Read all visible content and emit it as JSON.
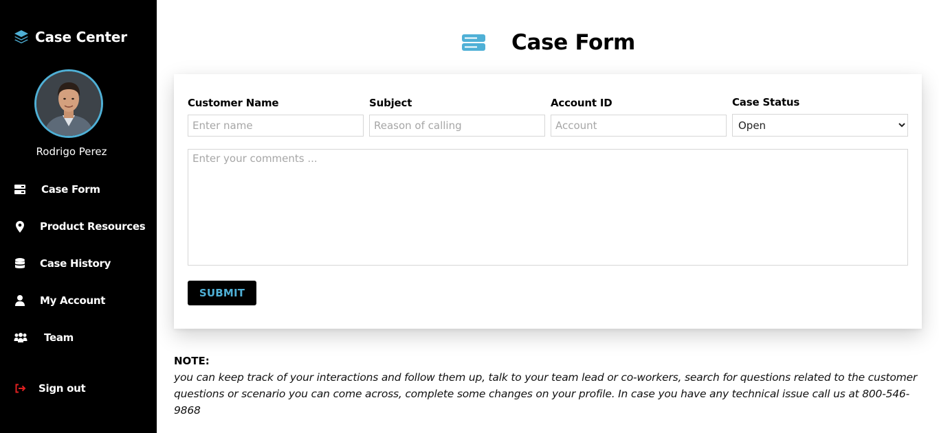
{
  "sidebar": {
    "brand": {
      "title": "Case Center",
      "icon": "layers-icon"
    },
    "user": {
      "name": "Rodrigo Perez",
      "avatar_icon": "avatar"
    },
    "items": [
      {
        "label": "Case Form",
        "icon": "server-icon"
      },
      {
        "label": "Product Resources",
        "icon": "map-pin-icon"
      },
      {
        "label": "Case History",
        "icon": "database-icon"
      },
      {
        "label": "My Account",
        "icon": "user-icon"
      },
      {
        "label": "Team",
        "icon": "users-icon"
      }
    ],
    "signout": {
      "label": "Sign out",
      "icon": "sign-out-icon",
      "color": "#e02020"
    }
  },
  "header": {
    "title": "Case Form",
    "icon": "server-icon",
    "accent": "#4fb0d6"
  },
  "form": {
    "customer_name": {
      "label": "Customer Name",
      "placeholder": "Enter name"
    },
    "subject": {
      "label": "Subject",
      "placeholder": "Reason of calling"
    },
    "account_id": {
      "label": "Account ID",
      "placeholder": "Account"
    },
    "case_status": {
      "label": "Case Status",
      "selected": "Open"
    },
    "comments": {
      "placeholder": "Enter your comments ..."
    },
    "submit_label": "SUBMIT"
  },
  "note": {
    "heading": "NOTE:",
    "body": "you can keep track of your interactions and follow them up, talk to your team lead or co-workers, search for questions related to the customer questions or scenario you can come across, complete some changes on your profile. In case you have any technical issue call us at 800-546-9868"
  }
}
